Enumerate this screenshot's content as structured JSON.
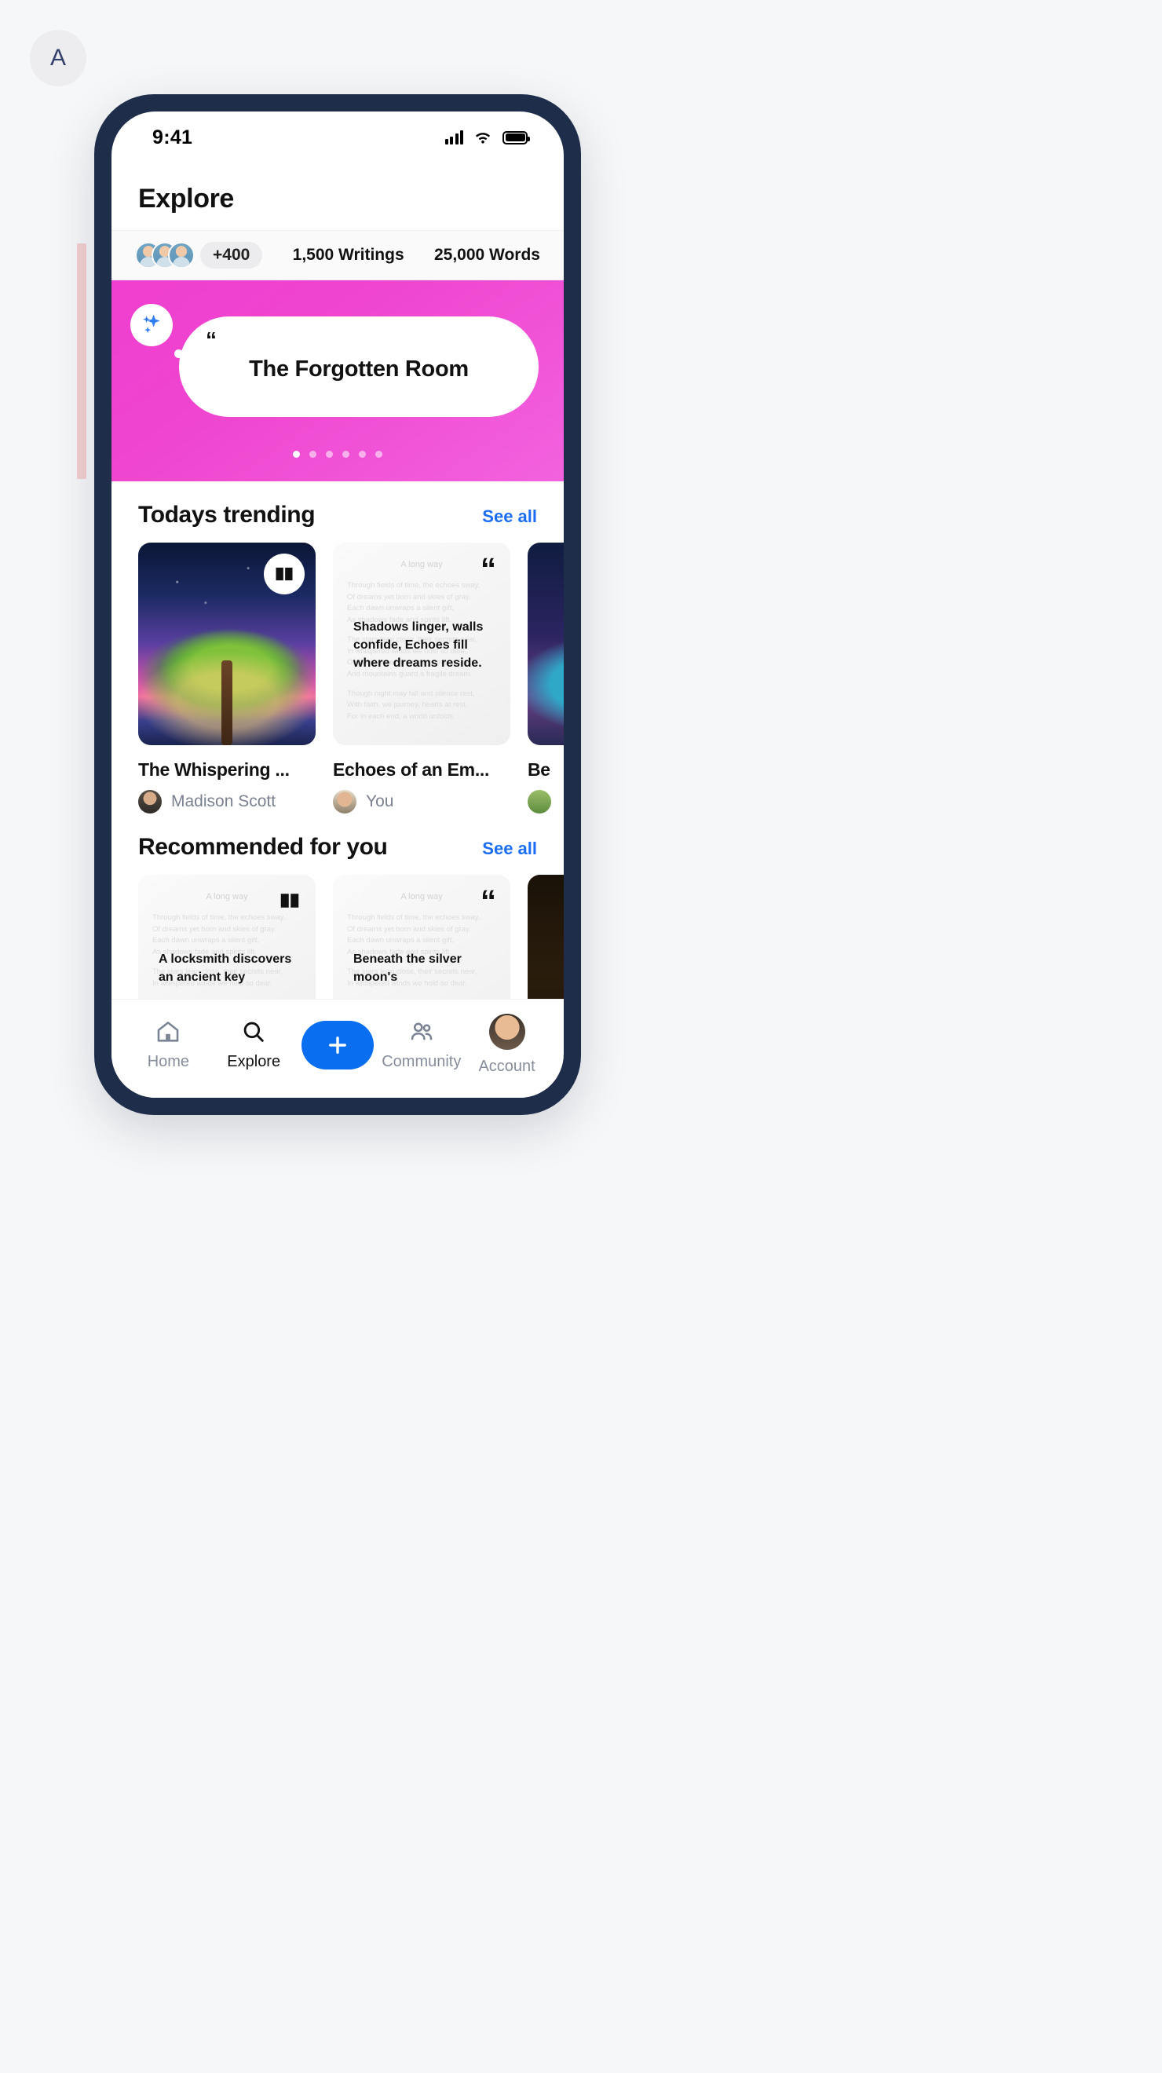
{
  "page": {
    "avatar_initial": "A"
  },
  "status_bar": {
    "time": "9:41",
    "signal_icon": "signal-bars-icon",
    "wifi_icon": "wifi-icon",
    "battery_icon": "battery-icon"
  },
  "header": {
    "title": "Explore"
  },
  "stats": {
    "avatars_badge": "+400",
    "items": [
      {
        "label": "1,500 Writings"
      },
      {
        "label": "25,000 Words"
      }
    ]
  },
  "hero": {
    "sparkle_icon": "sparkles-icon",
    "quote_mark": "“",
    "title": "The Forgotten Room",
    "dots_total": 6,
    "dots_active_index": 0,
    "background_color": "#ef45cf"
  },
  "sections": [
    {
      "title": "Todays trending",
      "see_all": "See all",
      "cards": [
        {
          "kind": "art",
          "badge_icon": "book-open-icon",
          "title": "The Whispering ...",
          "author": "Madison Scott",
          "avatar": "w"
        },
        {
          "kind": "quote",
          "badge_icon": "quote-icon",
          "bg_title": "A long way",
          "bg_lines": [
            "Through fields of time, the echoes sway,",
            "Of dreams yet born and skies of gray.",
            "Each dawn unwraps a silent gift,",
            "As shadows fade and spirits lift.",
            "The stars lean close, their secrets near,",
            "In whispered winds we hold so dear,",
            "Of roads unseen, where rivers gleam,",
            "And mountains guard a fragile dream.",
            "Though night may fall and silence rest,",
            "With faith, we journey, hearts at rest.",
            "For in each end, a world unfolds."
          ],
          "overlay": "Shadows linger, walls confide, Echoes fill where dreams reside.",
          "title": "Echoes of an Em...",
          "author": "You",
          "avatar": "m"
        },
        {
          "kind": "dark",
          "title": "Be",
          "author": "",
          "avatar": "g"
        }
      ]
    },
    {
      "title": "Recommended for you",
      "see_all": "See all",
      "cards": [
        {
          "kind": "quote",
          "badge_icon": "book-open-icon",
          "bg_title": "A long way",
          "bg_lines": [
            "Through fields of time, the echoes sway,",
            "Of dreams yet born and skies of gray.",
            "Each dawn unwraps a silent gift,",
            "As shadows fade and spirits lift.",
            "The stars lean close, their secrets near,",
            "In whispered winds we hold so dear."
          ],
          "overlay": "A locksmith discovers an ancient key"
        },
        {
          "kind": "quote",
          "badge_icon": "quote-icon",
          "bg_title": "A long way",
          "bg_lines": [
            "Through fields of time, the echoes sway,",
            "Of dreams yet born and skies of gray.",
            "Each dawn unwraps a silent gift,",
            "As shadows fade and spirits lift.",
            "The stars lean close, their secrets near,",
            "In whispered winds we hold so dear."
          ],
          "overlay": "Beneath the silver moon's"
        },
        {
          "kind": "door",
          "overlay": ""
        }
      ]
    }
  ],
  "tabbar": {
    "items": [
      {
        "label": "Home",
        "icon": "home-icon",
        "active": false
      },
      {
        "label": "Explore",
        "icon": "search-icon",
        "active": true
      },
      {
        "label": "",
        "icon": "plus-icon",
        "active": false
      },
      {
        "label": "Community",
        "icon": "people-icon",
        "active": false
      },
      {
        "label": "Account",
        "icon": "avatar-icon",
        "active": false
      }
    ],
    "accent_color": "#0a6ef0"
  }
}
